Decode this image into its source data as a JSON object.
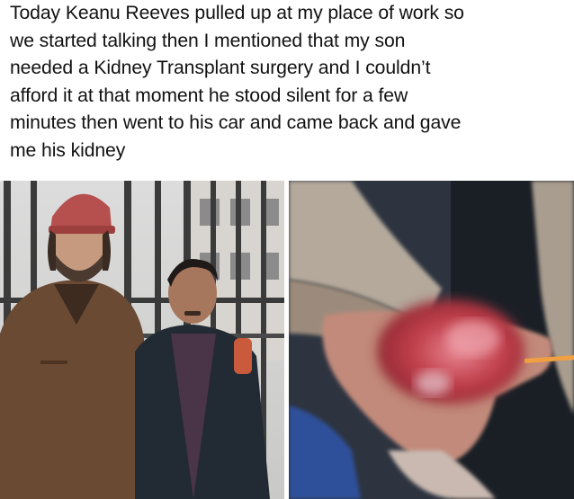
{
  "caption": {
    "text": "Today Keanu Reeves pulled up at my place of work so\nwe started talking then I mentioned that my son\nneeded a Kidney Transplant surgery and I couldn’t\nafford it at that moment he stood silent for a few\nminutes then went to his car and came back and gave\nme his kidney"
  },
  "photos": {
    "left": {
      "icon": "two-men-posing-photo"
    },
    "right": {
      "icon": "hand-holding-bloody-organ-photo"
    }
  },
  "colors": {
    "background": "#ffffff",
    "text": "#111111",
    "jacket_brown": "#6b4a33",
    "cap_red": "#b5504e",
    "vest_black": "#222a33",
    "shirt_purple": "#4a3447",
    "blood_red": "#c1404c"
  }
}
